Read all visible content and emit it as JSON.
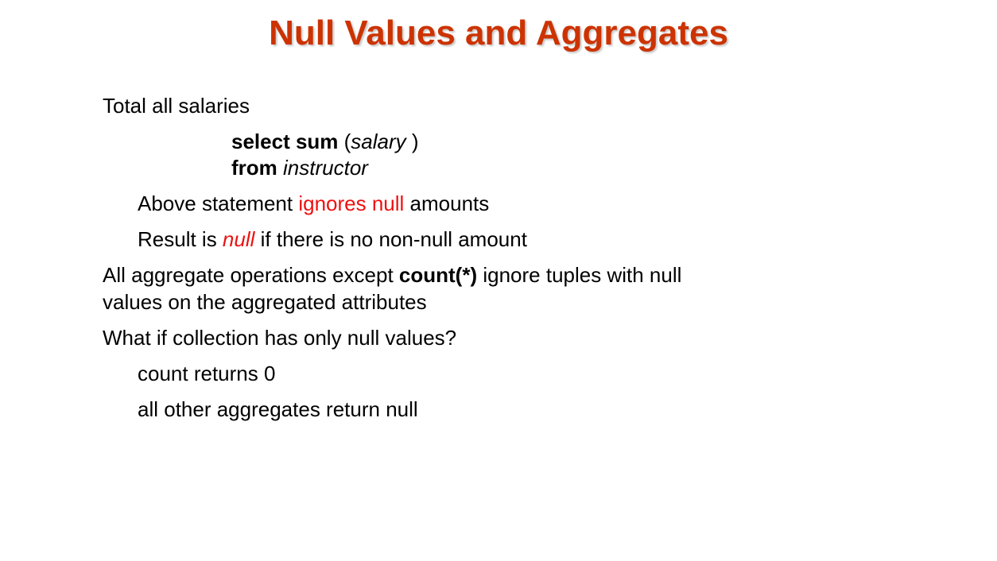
{
  "title": "Null Values and Aggregates",
  "accent_color": "#cc3300",
  "highlight_color": "#ee1111",
  "bullets": {
    "total_all_salaries": "Total all salaries",
    "query": {
      "select_kw": "select sum",
      "open_paren": " (",
      "salary": "salary",
      "close_paren": " )",
      "from_kw": "from",
      "space": " ",
      "instructor": "instructor"
    },
    "above_statement": {
      "before": "Above statement ",
      "highlight": "ignores null",
      "after": " amounts"
    },
    "result_is": {
      "before": "Result is ",
      "highlight": "null",
      "after": " if there is no non-null amount"
    },
    "all_aggregate": {
      "before": "All aggregate operations except ",
      "bold": "count(*)",
      "after": " ignore tuples with null",
      "line2": "values on the aggregated attributes"
    },
    "what_if": "What if collection has only null values?",
    "count_returns": "count returns 0",
    "all_other": "all other aggregates return null"
  }
}
